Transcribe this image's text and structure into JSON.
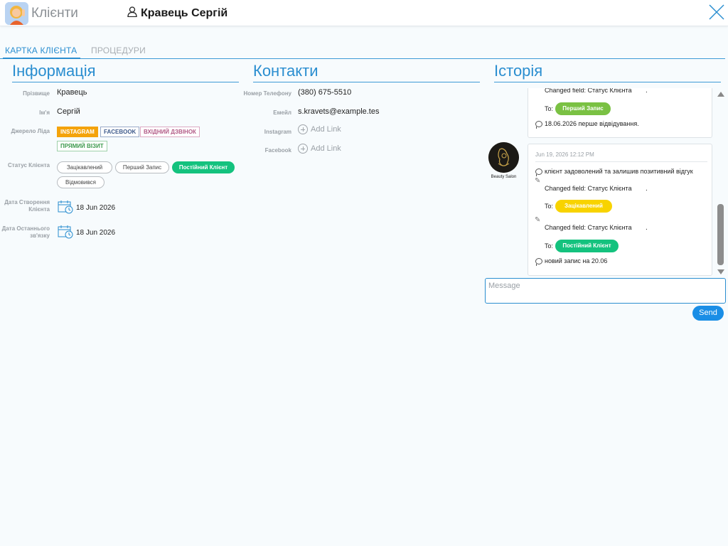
{
  "header": {
    "app_title": "Клієнти",
    "client_name": "Кравець Сергій"
  },
  "tabs": [
    {
      "label": "КАРТКА КЛІЄНТА",
      "active": true
    },
    {
      "label": "ПРОЦЕДУРИ",
      "active": false
    }
  ],
  "sections": {
    "info": "Інформація",
    "contacts": "Контакти",
    "history": "Історія"
  },
  "info": {
    "surname_label": "Прізвище",
    "surname": "Кравець",
    "name_label": "Ім'я",
    "name": "Сергій",
    "lead_source_label": "Джерело Ліда",
    "lead_sources": [
      "INSTAGRAM",
      "FACEBOOK",
      "ВХІДНИЙ ДЗВІНОК",
      "ПРЯМИЙ ВІЗИТ"
    ],
    "lead_source_selected": "INSTAGRAM",
    "status_label": "Статус Клієнта",
    "statuses": [
      "Зацікавлений",
      "Перший Запис",
      "Постійний Клієнт",
      "Відмовився"
    ],
    "status_selected": "Постійний Клієнт",
    "created_label": "Дата Створення Клієнта",
    "created_date": "18 Jun 2026",
    "last_contact_label": "Дата Останнього зв'язку",
    "last_contact_date": "18 Jun 2026"
  },
  "contacts": {
    "phone_label": "Номер Телефону",
    "phone": "(380) 675-5510",
    "email_label": "Емейл",
    "email": "s.kravets@example.tes",
    "instagram_label": "Instagram",
    "facebook_label": "Facebook",
    "add_link_label": "Add Link"
  },
  "history": {
    "entry1": {
      "changed_text": "Changed field: Статус Клієнта",
      "dot": ".",
      "to_label": "To:",
      "to_status": "Перший Запис",
      "comment": "18.06.2026 перше відвідування."
    },
    "entry2": {
      "timestamp": "Jun 19, 2026 12:12 PM",
      "author": "Beauty Salon",
      "comment": "клієнт задоволений та залишив позитивний відгук",
      "change1_text": "Changed field: Статус Клієнта",
      "change1_to_label": "To:",
      "change1_status": "Зацікавлений",
      "change2_text": "Changed field: Статус Клієнта",
      "change2_to_label": "To:",
      "change2_status": "Постійний Клієнт",
      "dot": ".",
      "comment2": "новий запис на 20.06"
    }
  },
  "message": {
    "placeholder": "Message",
    "send_label": "Send"
  },
  "colors": {
    "accent": "#2a8ed0",
    "instagram": "#f4a30b",
    "status_regular": "#14c27e",
    "status_first": "#7ac143",
    "status_interest": "#f8d300"
  }
}
